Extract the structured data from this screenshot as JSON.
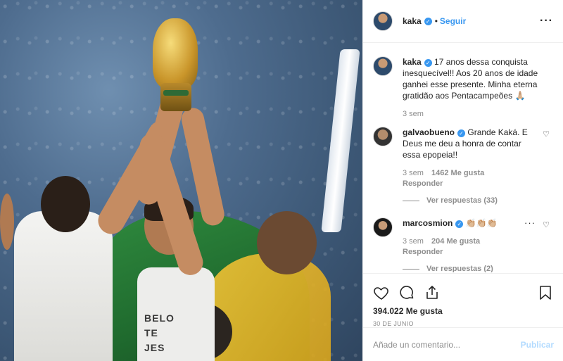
{
  "header": {
    "username": "kaka",
    "separator": "•",
    "follow_label": "Seguir",
    "more_label": "···"
  },
  "caption": {
    "username": "kaka",
    "text": "17 anos dessa conquista inesquecível!! Aos 20 anos de idade ganhei esse presente. Minha eterna gratidão aos Pentacampeões 🙏🏼",
    "time": "3 sem"
  },
  "comments": [
    {
      "username": "galvaobueno",
      "text": "Grande Kaká. E Deus me deu a honra de contar essa epopeia!!",
      "time": "3 sem",
      "likes": "1462 Me gusta",
      "reply_label": "Responder",
      "view_replies": "Ver respuestas (33)"
    },
    {
      "username": "marcosmion",
      "text": "👏🏼👏🏼👏🏼",
      "time": "3 sem",
      "likes": "204 Me gusta",
      "reply_label": "Responder",
      "view_replies": "Ver respuestas (2)",
      "options_label": "···"
    }
  ],
  "photo": {
    "shirt_text_lines": [
      "BELO",
      "TE",
      "JES"
    ]
  },
  "actions": {
    "likes": "394.022 Me gusta",
    "date": "30 DE JUNIO"
  },
  "add_comment": {
    "placeholder": "Añade un comentario...",
    "publish_label": "Publicar"
  },
  "colors": {
    "link_blue": "#3897f0",
    "verified_blue": "#3897f0",
    "muted_gray": "#8e8e8e",
    "publish_disabled": "#b3dbff"
  },
  "icons": [
    "heart-icon",
    "comment-icon",
    "share-icon",
    "bookmark-icon",
    "verified-icon",
    "more-options-icon"
  ]
}
